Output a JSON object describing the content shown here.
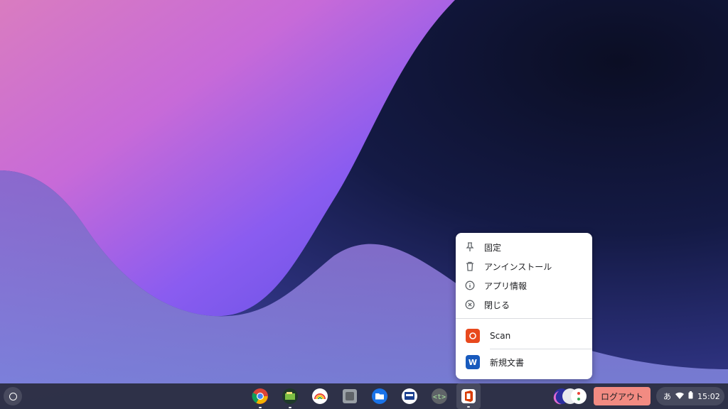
{
  "context_menu": {
    "items": [
      {
        "label": "固定",
        "icon": "pin-icon"
      },
      {
        "label": "アンインストール",
        "icon": "trash-icon"
      },
      {
        "label": "アプリ情報",
        "icon": "info-icon"
      },
      {
        "label": "閉じる",
        "icon": "close-circle-icon"
      }
    ],
    "shortcuts": [
      {
        "label": "Scan",
        "icon": "camera-icon"
      },
      {
        "label": "新規文書",
        "icon": "word-icon"
      }
    ]
  },
  "shelf": {
    "apps": [
      {
        "name": "chrome-app-icon",
        "running": true
      },
      {
        "name": "board-app-icon",
        "running": true
      },
      {
        "name": "rainbow-app-icon",
        "running": false
      },
      {
        "name": "square-app-icon",
        "running": false
      },
      {
        "name": "files-app-icon",
        "running": false
      },
      {
        "name": "scanner-app-icon",
        "running": false
      },
      {
        "name": "terminal-app-icon",
        "running": false
      },
      {
        "name": "office-app-icon",
        "running": true
      }
    ],
    "logout_label": "ログアウト",
    "tray": {
      "ime": "あ",
      "time": "15:02"
    }
  },
  "colors": {
    "logout_bg": "#f28b82",
    "menu_bg": "#ffffff"
  }
}
